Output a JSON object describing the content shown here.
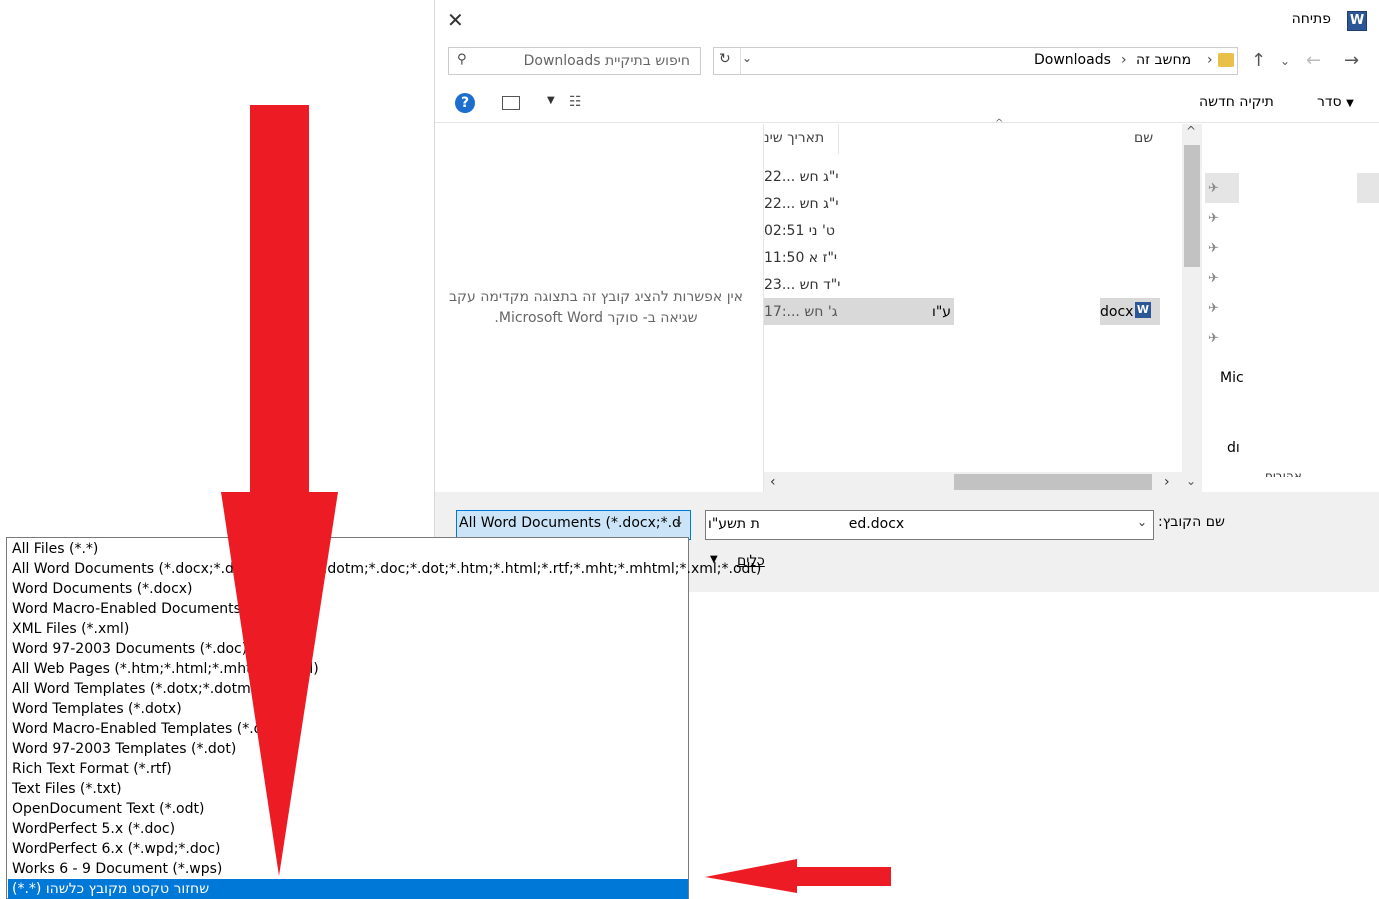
{
  "dialog": {
    "title": "פתיחה",
    "app_icon": "W",
    "close": "✕",
    "breadcrumb": [
      "Downloads",
      "מחשב זה"
    ],
    "search_placeholder": "חיפוש בתיקיית Downloads",
    "toolbar": {
      "organize": "סדר",
      "new_folder": "תיקיה חדשה",
      "help": "?"
    },
    "columns": {
      "name": "שם",
      "date": "תאריך שינ"
    },
    "dates": [
      "22... י\"ג חש",
      "22... י\"ג חש",
      "02:51 ט' ני",
      "11:50 י\"ז א",
      "23... י\"ד חש",
      "17:... ג' חש"
    ],
    "selected_row_name": "docx",
    "selected_row_frag": "ע\"ו",
    "preview_message_line1": "אין אפשרות להציג קובץ זה בתצוגה מקדימה עקב",
    "preview_message_line2": "שגיאה ב- סוקר Microsoft Word.",
    "side_labels": [
      "Mic",
      "dı",
      "אהובים"
    ],
    "filename_label": "שם הקובץ:",
    "filename_value": "ת תשע\"ו                    ed.docx",
    "filetype_value": "All Word Documents (*.docx;*.d",
    "tools_label": "כלים"
  },
  "filetype_list": [
    "All Files (*.*)",
    "All Word Documents (*.docx;*.docm;*.dotx;*.dotm;*.doc;*.dot;*.htm;*.html;*.rtf;*.mht;*.mhtml;*.xml;*.odt)",
    "Word Documents (*.docx)",
    "Word Macro-Enabled Documents (*.docm)",
    "XML Files (*.xml)",
    "Word 97-2003 Documents (*.doc)",
    "All Web Pages (*.htm;*.html;*.mht;*.mhtml)",
    "All Word Templates (*.dotx;*.dotm;*.dot)",
    "Word Templates (*.dotx)",
    "Word Macro-Enabled Templates (*.dotm)",
    "Word 97-2003 Templates (*.dot)",
    "Rich Text Format (*.rtf)",
    "Text Files (*.txt)",
    "OpenDocument Text (*.odt)",
    "WordPerfect 5.x (*.doc)",
    "WordPerfect 6.x (*.wpd;*.doc)",
    "Works 6 - 9 Document (*.wps)"
  ],
  "selected_item": "שחזור טקסט מקובץ כלשהו (*.*)",
  "colors": {
    "arrow": "#ed1c24",
    "selection": "#0078d7"
  }
}
